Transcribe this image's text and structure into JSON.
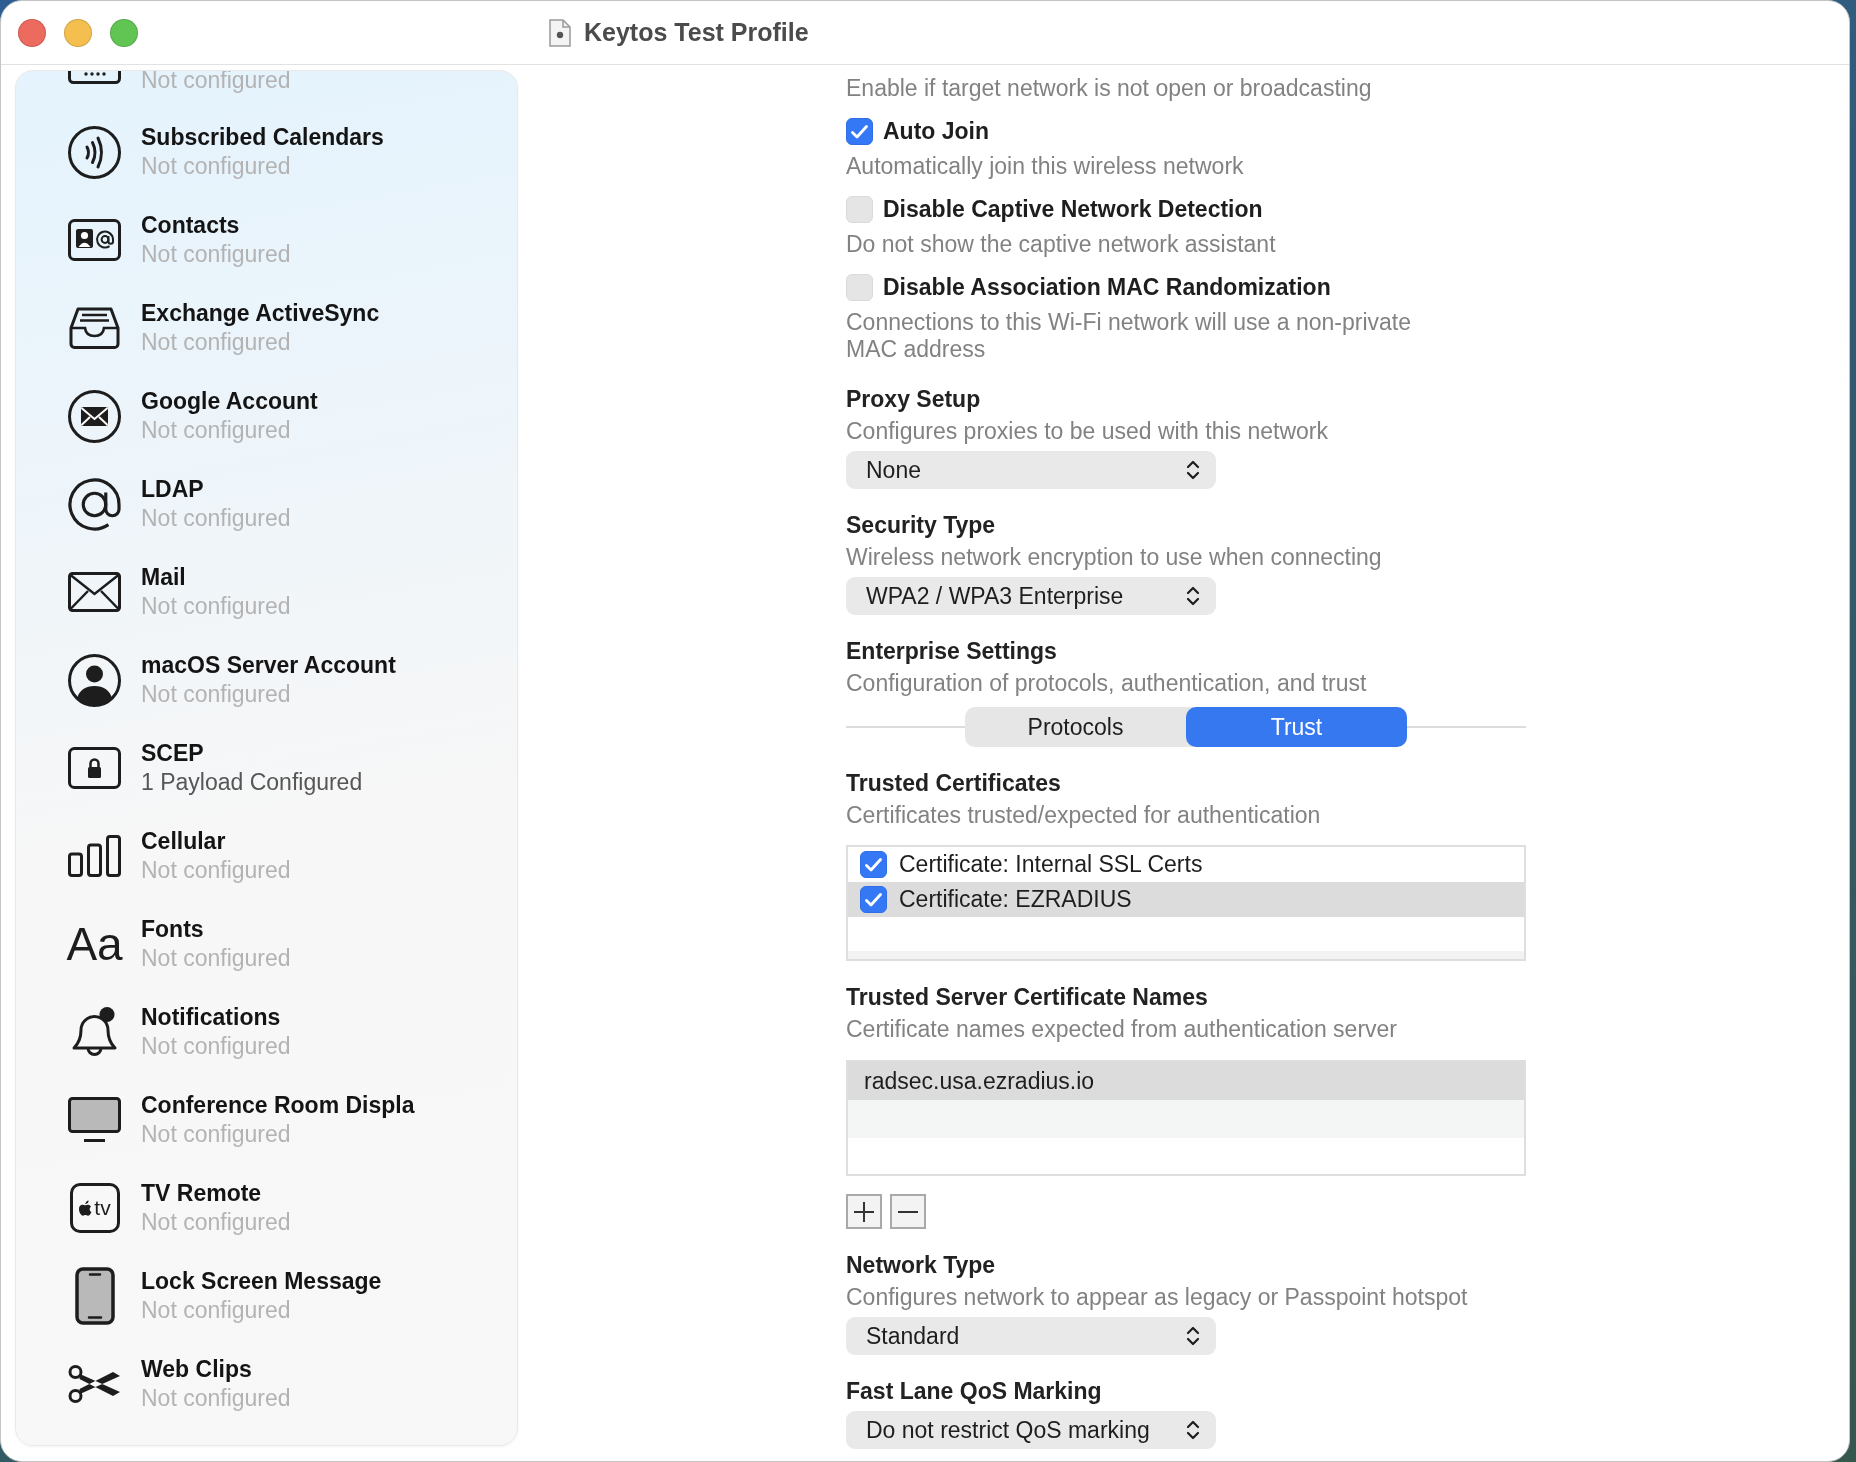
{
  "window": {
    "title": "Keytos Test Profile"
  },
  "sidebar": {
    "partial_item": {
      "subtitle": "Not configured",
      "configured": false
    },
    "items": [
      {
        "title": "Subscribed Calendars",
        "subtitle": "Not configured",
        "configured": false
      },
      {
        "title": "Contacts",
        "subtitle": "Not configured",
        "configured": false
      },
      {
        "title": "Exchange ActiveSync",
        "subtitle": "Not configured",
        "configured": false
      },
      {
        "title": "Google Account",
        "subtitle": "Not configured",
        "configured": false
      },
      {
        "title": "LDAP",
        "subtitle": "Not configured",
        "configured": false
      },
      {
        "title": "Mail",
        "subtitle": "Not configured",
        "configured": false
      },
      {
        "title": "macOS Server Account",
        "subtitle": "Not configured",
        "configured": false
      },
      {
        "title": "SCEP",
        "subtitle": "1 Payload Configured",
        "configured": true
      },
      {
        "title": "Cellular",
        "subtitle": "Not configured",
        "configured": false
      },
      {
        "title": "Fonts",
        "subtitle": "Not configured",
        "configured": false,
        "icon_text": "Aa"
      },
      {
        "title": "Notifications",
        "subtitle": "Not configured",
        "configured": false
      },
      {
        "title": "Conference Room Displa",
        "subtitle": "Not configured",
        "configured": false
      },
      {
        "title": "TV Remote",
        "subtitle": "Not configured",
        "configured": false,
        "icon_text": "tv"
      },
      {
        "title": "Lock Screen Message",
        "subtitle": "Not configured",
        "configured": false
      },
      {
        "title": "Web Clips",
        "subtitle": "Not configured",
        "configured": false
      }
    ]
  },
  "settings": [
    {
      "kind": "note",
      "text": "Enable if target network is not open or broadcasting"
    },
    {
      "kind": "checkbox",
      "label": "Auto Join",
      "checked": true,
      "description": "Automatically join this wireless network"
    },
    {
      "kind": "checkbox",
      "label": "Disable Captive Network Detection",
      "checked": false,
      "description": "Do not show the captive network assistant"
    },
    {
      "kind": "checkbox",
      "label": "Disable Association MAC Randomization",
      "checked": false,
      "description": "Connections to this Wi-Fi network will use a non-private MAC address"
    },
    {
      "kind": "popup",
      "heading": "Proxy Setup",
      "description": "Configures proxies to be used with this network",
      "value": "None"
    },
    {
      "kind": "popup",
      "heading": "Security Type",
      "description": "Wireless network encryption to use when connecting",
      "value": "WPA2 / WPA3 Enterprise"
    },
    {
      "kind": "segmented",
      "heading": "Enterprise Settings",
      "description": "Configuration of protocols, authentication, and trust",
      "segments": [
        {
          "label": "Protocols",
          "selected": false
        },
        {
          "label": "Trust",
          "selected": true
        }
      ]
    },
    {
      "kind": "checklist",
      "heading": "Trusted Certificates",
      "description": "Certificates trusted/expected for authentication",
      "rows": [
        {
          "label": "Certificate: Internal SSL Certs",
          "checked": true,
          "selected": false
        },
        {
          "label": "Certificate: EZRADIUS",
          "checked": true,
          "selected": true
        }
      ]
    },
    {
      "kind": "list",
      "heading": "Trusted Server Certificate Names",
      "description": "Certificate names expected from authentication server",
      "rows": [
        {
          "text": "radsec.usa.ezradius.io",
          "selected": true
        }
      ]
    },
    {
      "kind": "popup",
      "heading": "Network Type",
      "description": "Configures network to appear as legacy or Passpoint hotspot",
      "value": "Standard"
    },
    {
      "kind": "popup",
      "heading": "Fast Lane QoS Marking",
      "value": "Do not restrict QoS marking"
    }
  ]
}
